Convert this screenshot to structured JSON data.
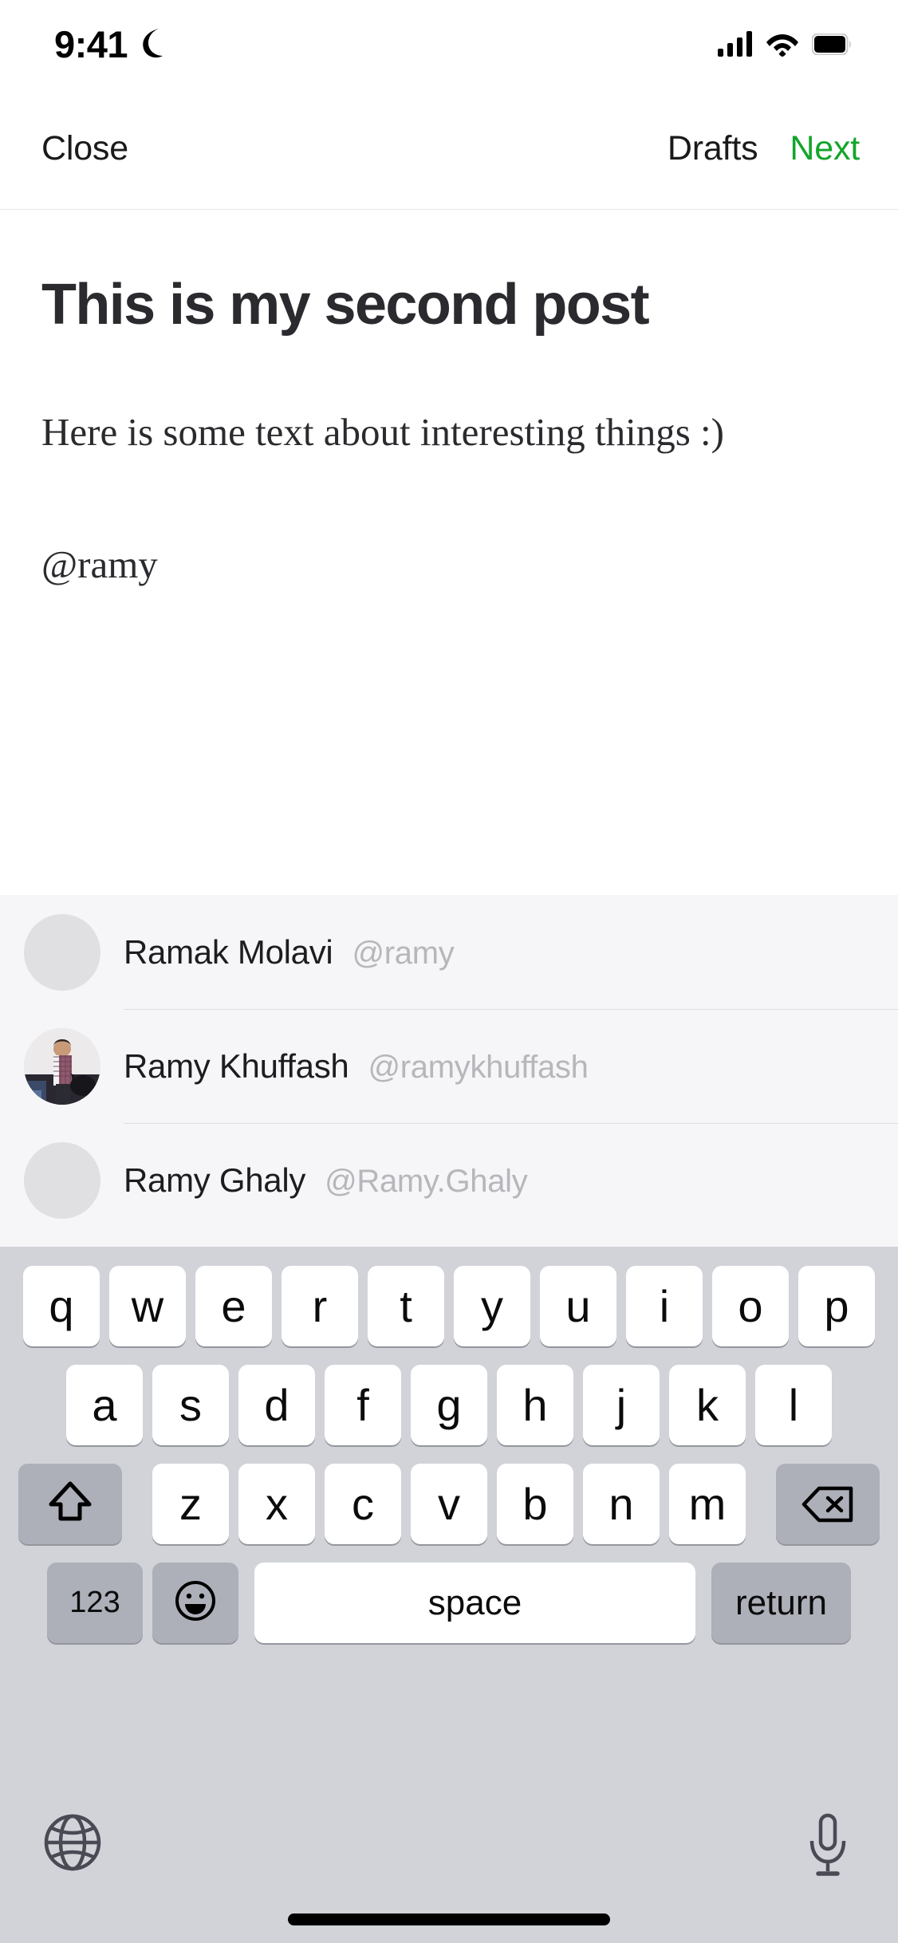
{
  "status_bar": {
    "time": "9:41",
    "icons": [
      "moon-icon",
      "cellular-signal-icon",
      "wifi-icon",
      "battery-icon"
    ]
  },
  "nav_bar": {
    "close_label": "Close",
    "drafts_label": "Drafts",
    "next_label": "Next",
    "next_color": "#13a52a"
  },
  "editor": {
    "title": "This is my second post",
    "body": "Here is some text about interesting things :)",
    "mention_token": "@ramy"
  },
  "suggestions": {
    "items": [
      {
        "name": "Ramak Molavi",
        "handle": "@ramy",
        "avatar": "placeholder"
      },
      {
        "name": "Ramy Khuffash",
        "handle": "@ramykhuffash",
        "avatar": "photo"
      },
      {
        "name": "Ramy Ghaly",
        "handle": "@Ramy.Ghaly",
        "avatar": "placeholder"
      }
    ]
  },
  "keyboard": {
    "row1": [
      "q",
      "w",
      "e",
      "r",
      "t",
      "y",
      "u",
      "i",
      "o",
      "p"
    ],
    "row2": [
      "a",
      "s",
      "d",
      "f",
      "g",
      "h",
      "j",
      "k",
      "l"
    ],
    "row3": [
      "z",
      "x",
      "c",
      "v",
      "b",
      "n",
      "m"
    ],
    "shift_label": "",
    "delete_label": "",
    "numbers_label": "123",
    "emoji_label": "",
    "space_label": "space",
    "return_label": "",
    "return_text": "return",
    "globe_label": "",
    "mic_label": "",
    "bg_color": "#d1d3d9",
    "key_color": "#ffffff",
    "modifier_key_color": "#adb0b9"
  }
}
